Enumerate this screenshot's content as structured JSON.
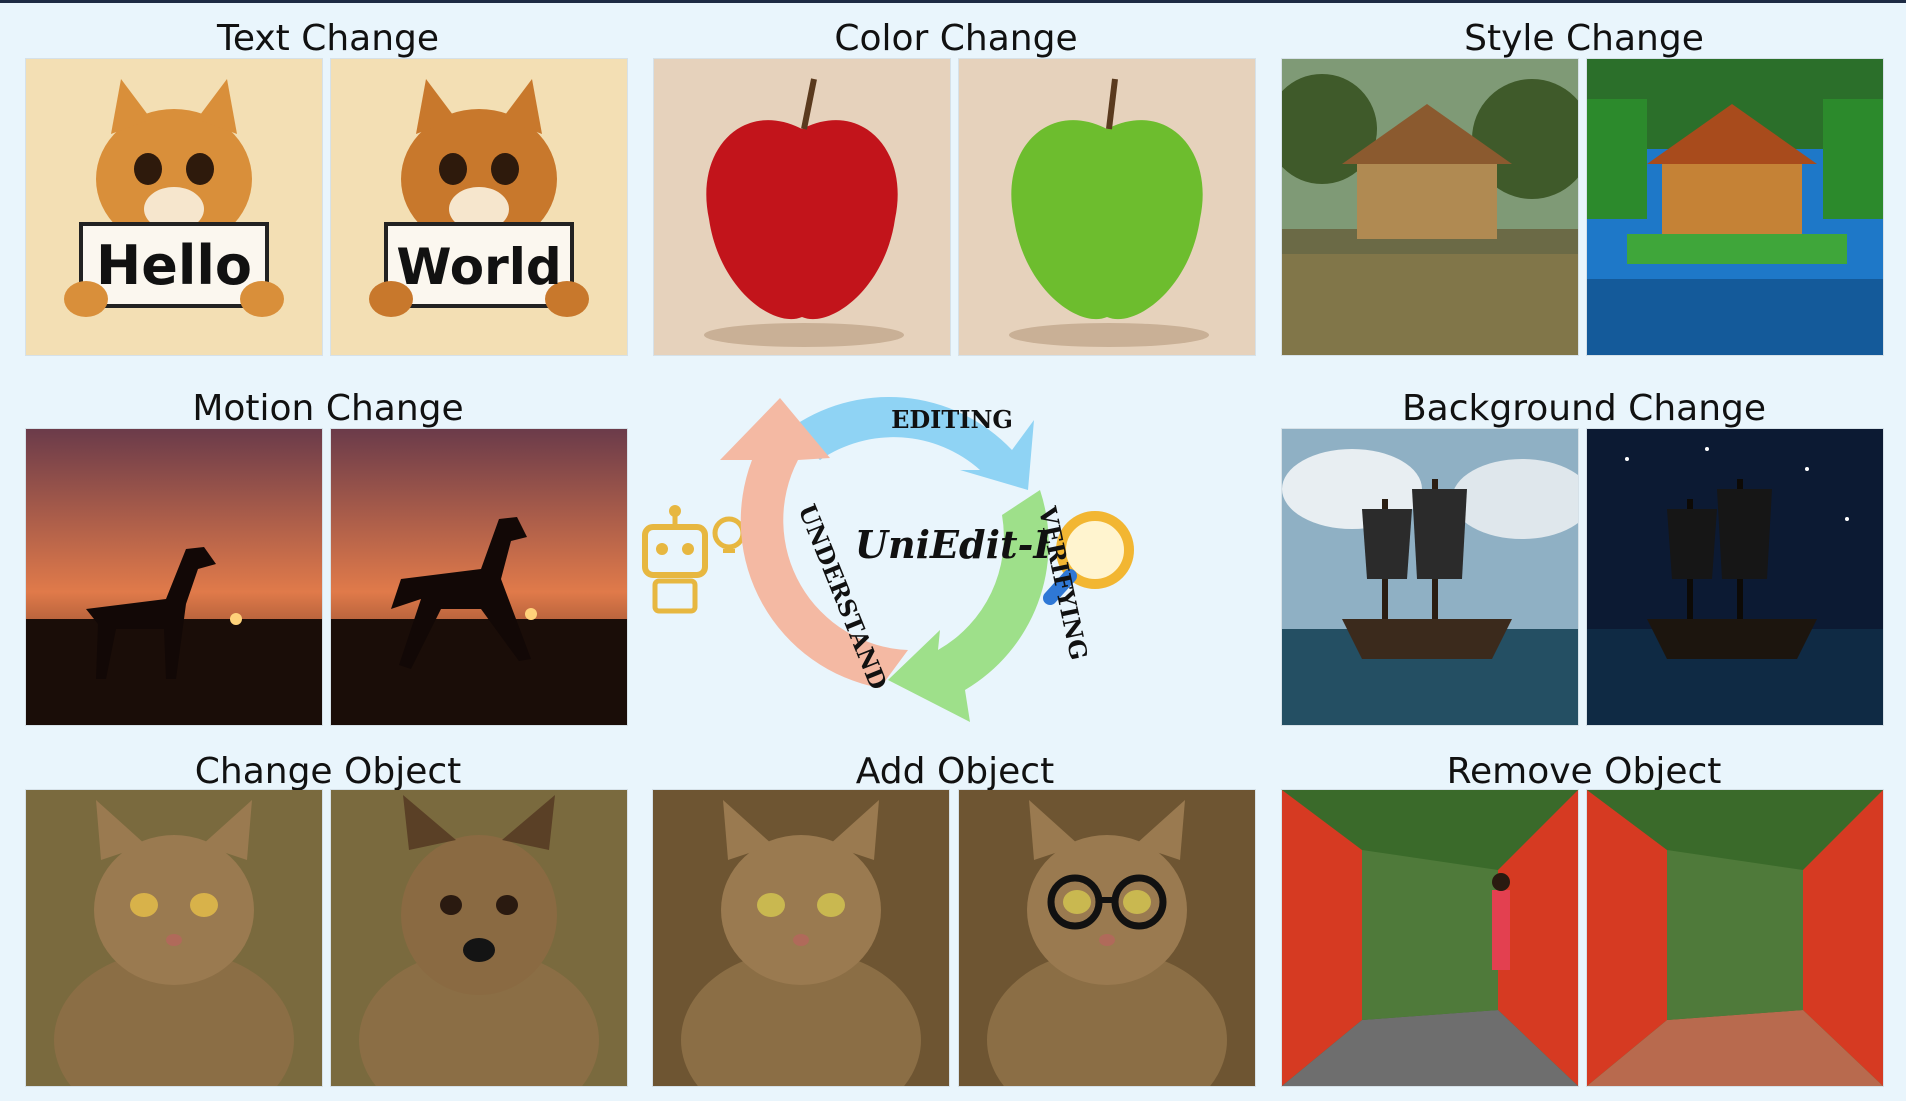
{
  "panels": {
    "text_change": {
      "title": "Text Change",
      "before_sign": "Hello",
      "after_sign": "World"
    },
    "color_change": {
      "title": "Color Change"
    },
    "style_change": {
      "title": "Style Change"
    },
    "motion_change": {
      "title": "Motion Change"
    },
    "background_change": {
      "title": "Background Change"
    },
    "change_object": {
      "title": "Change Object"
    },
    "add_object": {
      "title": "Add Object"
    },
    "remove_object": {
      "title": "Remove Object"
    }
  },
  "cycle": {
    "center": "UniEdit-I",
    "steps": [
      "EDITING",
      "VERIFYING",
      "UNDERSTAND"
    ],
    "colors": {
      "editing": "#8fd3f4",
      "verifying": "#9ee08a",
      "understand": "#f4b9a3"
    }
  },
  "icons": [
    "robot-lightbulb-icon",
    "magnifier-icon"
  ]
}
